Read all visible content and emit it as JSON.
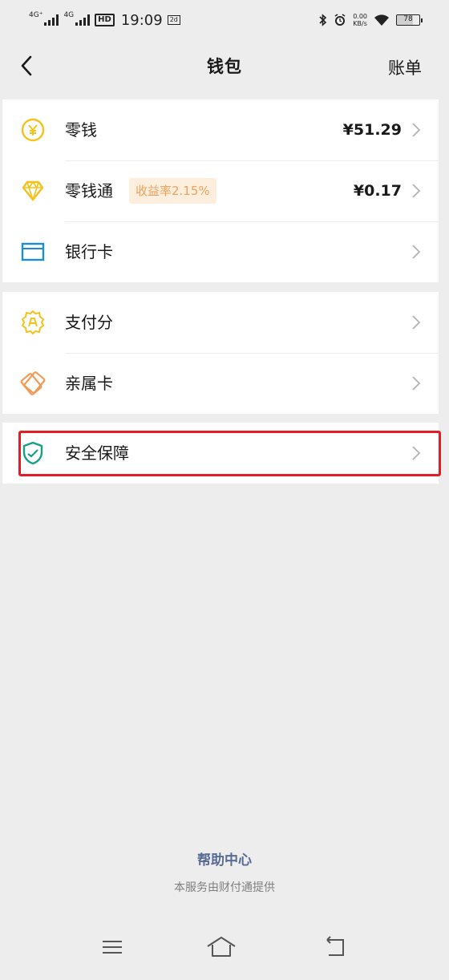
{
  "status_bar": {
    "network1": "4G⁺",
    "network2": "4G",
    "hd": "HD",
    "time": "19:09",
    "notif_badge": "2d",
    "speed_value": "0.00",
    "speed_unit": "KB/s",
    "battery": "78"
  },
  "nav": {
    "title": "钱包",
    "right_label": "账单"
  },
  "wallet": {
    "change": {
      "label": "零钱",
      "value": "¥51.29",
      "icon": "coin-icon",
      "color": "#f5c21b"
    },
    "change_pass": {
      "label": "零钱通",
      "badge": "收益率2.15%",
      "value": "¥0.17",
      "icon": "diamond-icon",
      "color": "#f5c21b"
    },
    "bank_card": {
      "label": "银行卡",
      "icon": "card-icon",
      "color": "#1b8fd6"
    }
  },
  "services": {
    "pay_score": {
      "label": "支付分",
      "icon": "pay-score-icon",
      "color": "#f5c21b"
    },
    "family_card": {
      "label": "亲属卡",
      "icon": "family-card-icon",
      "color": "#f39a55"
    }
  },
  "security": {
    "label": "安全保障",
    "icon": "shield-icon",
    "color": "#14a085",
    "highlight_color": "#e51c23"
  },
  "footer": {
    "help": "帮助中心",
    "provider": "本服务由财付通提供"
  }
}
